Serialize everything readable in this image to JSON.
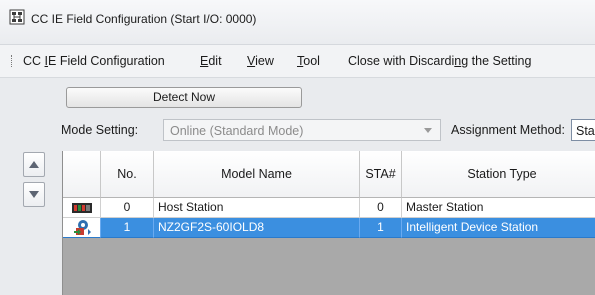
{
  "window": {
    "title": "CC IE Field Configuration (Start I/O: 0000)"
  },
  "menu": {
    "items": [
      {
        "pre": "CC ",
        "key": "I",
        "post": "E Field Configuration"
      },
      {
        "pre": "",
        "key": "E",
        "post": "dit"
      },
      {
        "pre": "",
        "key": "V",
        "post": "iew"
      },
      {
        "pre": "",
        "key": "T",
        "post": "ool"
      },
      {
        "pre": "Close with Discardi",
        "key": "n",
        "post": "g the Setting"
      }
    ]
  },
  "toolbar": {
    "detect_now_label": "Detect Now",
    "mode_setting_label": "Mode Setting:",
    "mode_setting_value": "Online (Standard Mode)",
    "assignment_method_label": "Assignment Method:",
    "assignment_method_value": "Sta"
  },
  "grid": {
    "columns": [
      "",
      "No.",
      "Model Name",
      "STA#",
      "Station Type"
    ],
    "rows": [
      {
        "icon": "host-station-icon",
        "no": "0",
        "model": "Host Station",
        "sta": "0",
        "type": "Master Station",
        "selected": false
      },
      {
        "icon": "intelligent-device-icon",
        "no": "1",
        "model": "NZ2GF2S-60IOLD8",
        "sta": "1",
        "type": "Intelligent Device Station",
        "selected": true
      }
    ]
  },
  "colors": {
    "selection": "#3b8fe0",
    "grid_background": "#a9a9a9"
  }
}
